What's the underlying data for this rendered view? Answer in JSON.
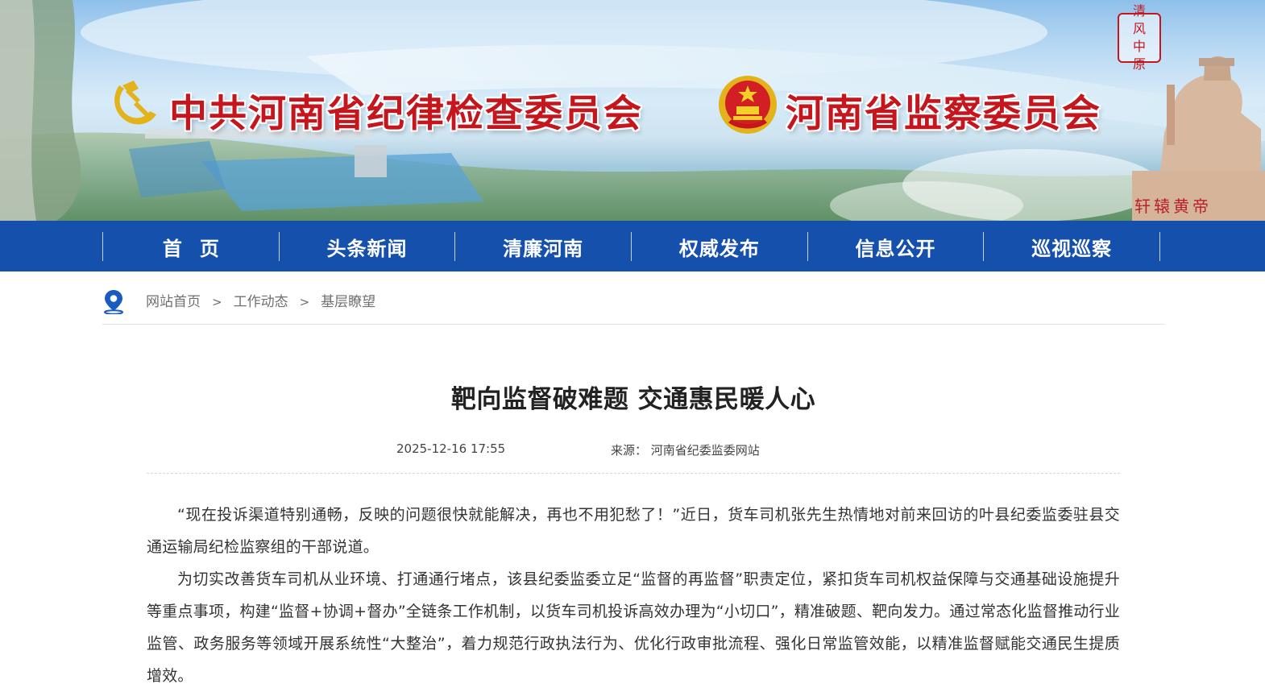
{
  "header": {
    "left_title": "中共河南省纪律检查委员会",
    "right_title": "河南省监察委员会",
    "seal_chars": [
      "清",
      "风",
      "中",
      "原"
    ],
    "statue_caption": "轩辕黄帝",
    "colors": {
      "title_red": "#c4161c",
      "nav_blue": "#1550ad"
    }
  },
  "nav": {
    "items": [
      "首页",
      "头条新闻",
      "清廉河南",
      "权威发布",
      "信息公开",
      "巡视巡察"
    ]
  },
  "breadcrumb": {
    "icon": "location-pin-icon",
    "items": [
      "网站首页",
      "工作动态",
      "基层瞭望"
    ],
    "separator": ">"
  },
  "article": {
    "title": "靶向监督破难题 交通惠民暖人心",
    "date": "2025-12-16 17:55",
    "source": "来源： 河南省纪委监委网站",
    "paragraphs": [
      "“现在投诉渠道特别通畅，反映的问题很快就能解决，再也不用犯愁了！”近日，货车司机张先生热情地对前来回访的叶县纪委监委驻县交通运输局纪检监察组的干部说道。",
      "为切实改善货车司机从业环境、打通通行堵点，该县纪委监委立足“监督的再监督”职责定位，紧扣货车司机权益保障与交通基础设施提升等重点事项，构建“监督+协调+督办”全链条工作机制，以货车司机投诉高效办理为“小切口”，精准破题、靶向发力。通过常态化监督推动行业监管、政务服务等领域开展系统性“大整治”，着力规范行政执法行为、优化行政审批流程、强化日常监管效能，以精准监督赋能交通民生提质增效。"
    ]
  }
}
